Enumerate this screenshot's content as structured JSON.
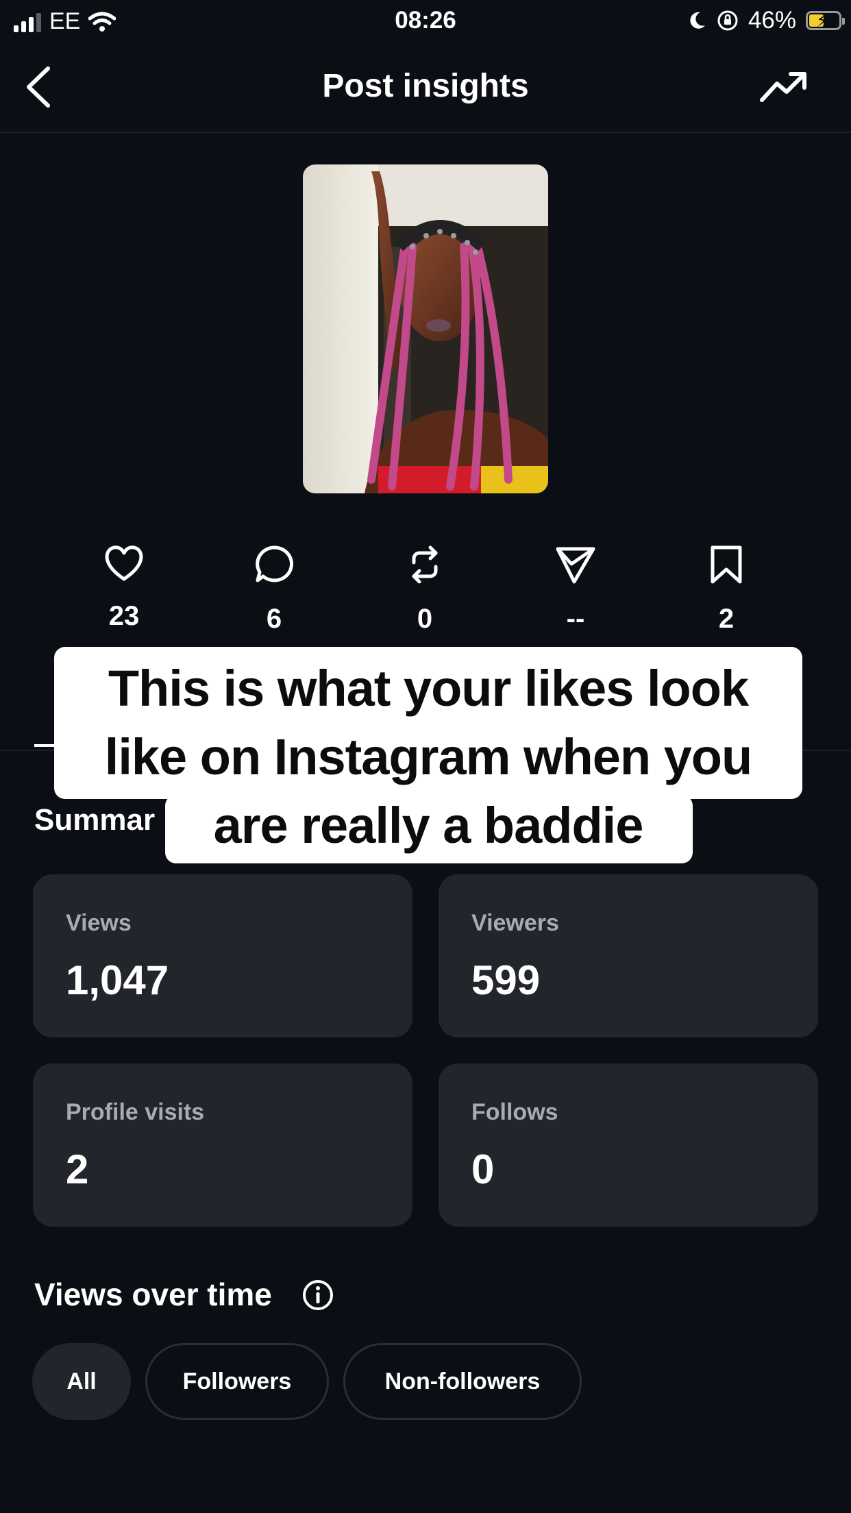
{
  "status_bar": {
    "carrier": "EE",
    "time": "08:26",
    "battery": "46%"
  },
  "header": {
    "title": "Post insights",
    "back_icon": "chevron-left-icon",
    "trend_icon": "trending-up-icon"
  },
  "actions": [
    {
      "icon": "heart-icon",
      "count": "23"
    },
    {
      "icon": "comment-icon",
      "count": "6"
    },
    {
      "icon": "repost-icon",
      "count": "0"
    },
    {
      "icon": "send-icon",
      "count": "--"
    },
    {
      "icon": "bookmark-icon",
      "count": "2"
    }
  ],
  "caption": {
    "line1": "This is what your likes look",
    "line2": "like on Instagram when you",
    "line3": "are really a baddie"
  },
  "summary": {
    "label": "Summar",
    "cards": [
      {
        "label": "Views",
        "value": "1,047"
      },
      {
        "label": "Viewers",
        "value": "599"
      },
      {
        "label": "Profile visits",
        "value": "2"
      },
      {
        "label": "Follows",
        "value": "0"
      }
    ]
  },
  "views_over_time": {
    "title": "Views over time",
    "filters": [
      "All",
      "Followers",
      "Non-followers"
    ],
    "selected": "All"
  },
  "colors": {
    "background": "#0b0e14",
    "card": "#22252c",
    "muted_text": "#a6abb6",
    "battery_fill": "#f3cd2f"
  }
}
